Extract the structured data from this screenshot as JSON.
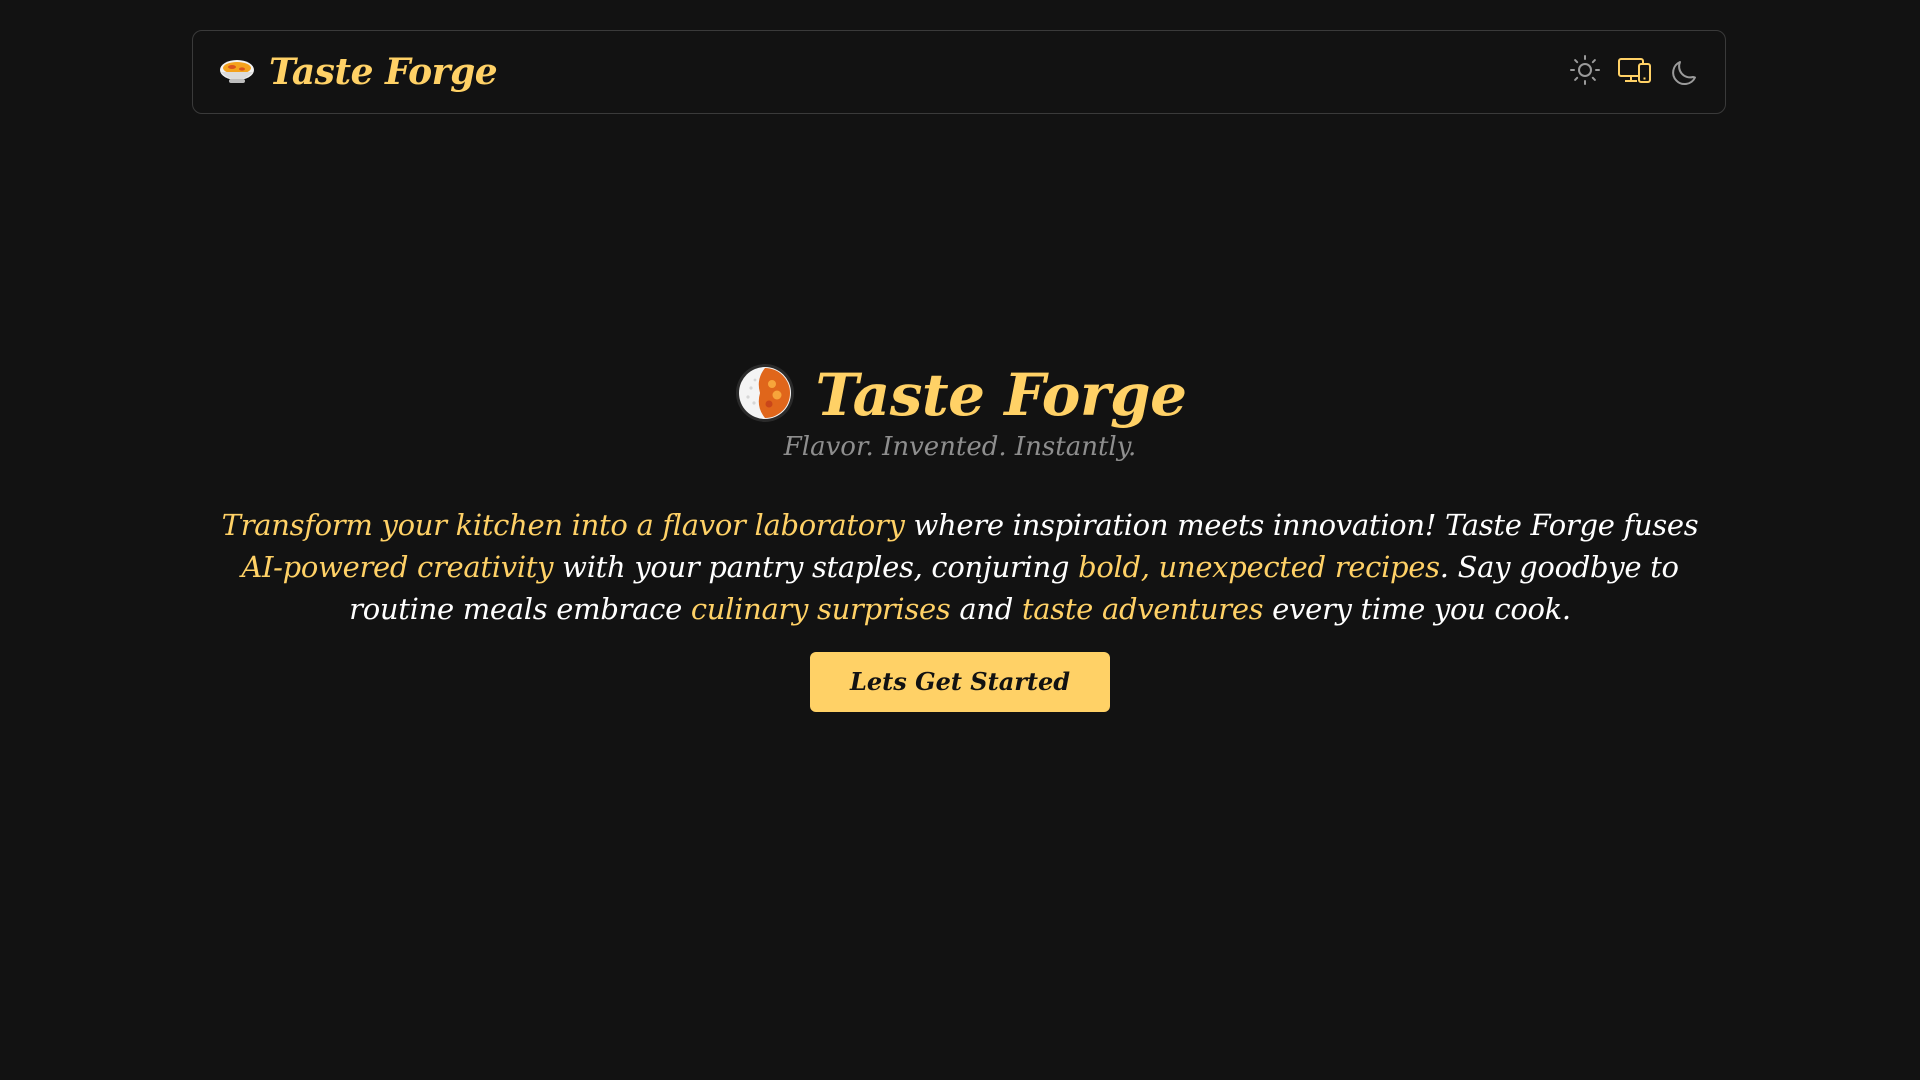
{
  "navbar": {
    "logo_icon": "curry-bowl-icon",
    "title": "Taste Forge",
    "toggles": [
      {
        "name": "sun-icon",
        "label": "light"
      },
      {
        "name": "devices-icon",
        "label": "system"
      },
      {
        "name": "moon-icon",
        "label": "dark"
      }
    ]
  },
  "hero": {
    "icon": "curry-rice-icon",
    "title": "Taste Forge",
    "tagline": "Flavor. Invented. Instantly.",
    "description": {
      "p1": "Transform your kitchen into a flavor laboratory",
      "p2": " where inspiration meets innovation! Taste Forge fuses ",
      "p3": "AI-powered creativity",
      "p4": " with your pantry staples, conjuring ",
      "p5": "bold, unexpected recipes",
      "p6": ". Say goodbye to routine meals embrace ",
      "p7": "culinary surprises",
      "p8": " and ",
      "p9": "taste adventures",
      "p10": " every time you cook."
    },
    "cta_label": "Lets Get Started"
  },
  "colors": {
    "background": "#121212",
    "accent": "#ffd166",
    "muted": "#8e8e8e",
    "border": "#3a3a3a"
  }
}
